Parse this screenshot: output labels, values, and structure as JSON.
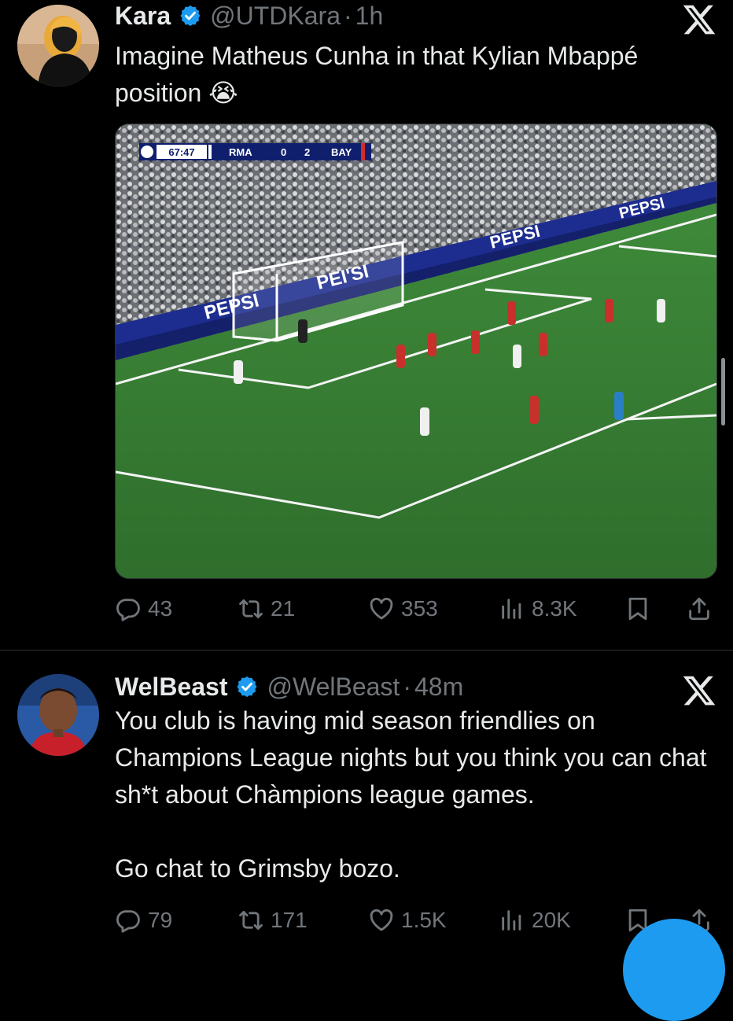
{
  "colors": {
    "background": "#000000",
    "text": "#e7e9ea",
    "muted": "#71767b",
    "verified": "#1d9bf0",
    "divider": "#2f3336"
  },
  "tweets": [
    {
      "author": "Kara",
      "handle": "@UTDKara",
      "separator": "·",
      "time": "1h",
      "text": "Imagine Matheus Cunha in that Kylian Mbappé position 😭",
      "media": {
        "scoreboard": {
          "clock": "67:47",
          "home": "RMA",
          "home_score": "0",
          "away_score": "2",
          "away": "BAY"
        },
        "ad_boards": [
          "PEPSI",
          "PEPSI",
          "PEPSI",
          "PEI'SI"
        ]
      },
      "stats": {
        "replies": "43",
        "reposts": "21",
        "likes": "353",
        "views": "8.3K"
      }
    },
    {
      "author": "WelBeast",
      "handle": "@WelBeast",
      "separator": "·",
      "time": "48m",
      "text": "You club is having mid season friendlies on Champions League nights but you think you can chat sh*t about Chàmpions league games.\n\nGo chat to Grimsby bozo.",
      "stats": {
        "replies": "79",
        "reposts": "171",
        "likes": "1.5K",
        "views": "20K"
      }
    }
  ],
  "icons": {
    "verified": "verified-badge-icon",
    "x_logo": "x-logo-icon",
    "reply": "reply-icon",
    "repost": "repost-icon",
    "like": "heart-icon",
    "views": "views-icon",
    "bookmark": "bookmark-icon",
    "share": "share-icon"
  }
}
